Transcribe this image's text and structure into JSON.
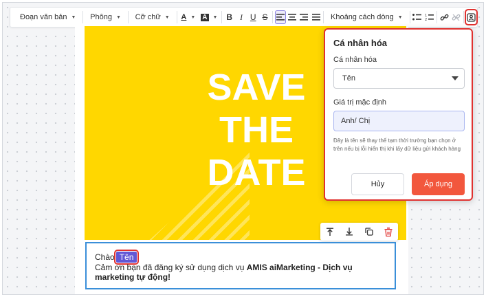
{
  "toolbar": {
    "paragraph_label": "Đoạn văn bản",
    "font_label": "Phông",
    "size_label": "Cỡ chữ",
    "text_color_label": "A",
    "bg_color_label": "A",
    "bold_label": "B",
    "italic_label": "I",
    "underline_label": "U",
    "strike_label": "S",
    "spacing_label": "Khoảng cách dòng"
  },
  "banner": {
    "line1": "SAVE",
    "line2": "THE",
    "line3": "DATE",
    "background_color": "#ffd700"
  },
  "text_block": {
    "greeting": "Chào",
    "tag_label": "Tên",
    "body_prefix": "Cảm ơn bạn đã đăng ký sử dụng dịch vụ ",
    "body_bold": "AMIS aiMarketing - Dịch vụ marketing tự động!"
  },
  "panel": {
    "title": "Cá nhân hóa",
    "select_label": "Cá nhân hóa",
    "select_value": "Tên",
    "default_label": "Giá trị mặc định",
    "default_value": "Anh/ Chị",
    "help_text": "Đây là tên sẽ thay thế tạm thời trường bạn chọn ở trên nếu bị lỗi hiển thị khi lấy dữ liệu gửi khách hàng",
    "cancel_label": "Hủy",
    "apply_label": "Áp dụng"
  },
  "colors": {
    "accent": "#6257d6",
    "apply": "#f2573d",
    "highlight": "#e0312f",
    "selection": "#3a8fd9"
  }
}
